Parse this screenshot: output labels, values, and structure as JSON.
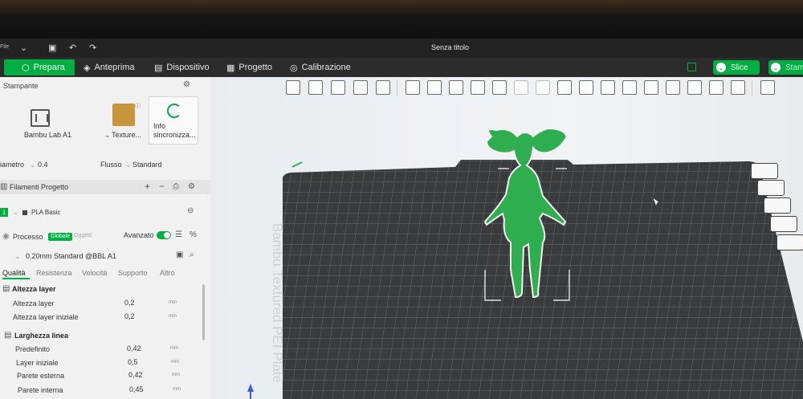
{
  "titlebar": {
    "file_menu": "File",
    "title": "Senza titolo"
  },
  "nav": {
    "tabs": [
      {
        "label": "Prepara",
        "active": true
      },
      {
        "label": "Anteprima"
      },
      {
        "label": "Dispositivo"
      },
      {
        "label": "Progetto"
      },
      {
        "label": "Calibrazione"
      }
    ],
    "slice_label": "Slice",
    "print_label": "Stam"
  },
  "printer": {
    "section_title": "Stampante",
    "printer_name": "Bambu Lab A1",
    "plate_label": "Texture...",
    "sync_line1": "Info",
    "sync_line2": "sincronizza...",
    "nozzle_label": "iametro",
    "nozzle_value": "0.4",
    "flow_label": "Flusso",
    "flow_value": "Standard"
  },
  "filaments": {
    "section_title": "Filamenti Progetto",
    "index": "1",
    "name": "PLA Basic"
  },
  "process": {
    "section_title": "Processo",
    "badge_global": "Globale",
    "badge_objects": "Oggetti",
    "advanced_label": "Avanzato",
    "advanced_on": true,
    "preset": "0.20mm Standard @BBL A1",
    "tabs": [
      "Qualità",
      "Resistenza",
      "Velocità",
      "Supporto",
      "Altro"
    ],
    "groups": [
      {
        "title": "Altezza layer",
        "rows": [
          {
            "label": "Altezza layer",
            "value": "0,2",
            "unit": "mm"
          },
          {
            "label": "Altezza layer iniziale",
            "value": "0,2",
            "unit": "mm"
          }
        ]
      },
      {
        "title": "Larghezza linea",
        "rows": [
          {
            "label": "Predefinito",
            "value": "0,42",
            "unit": "mm"
          },
          {
            "label": "Layer iniziale",
            "value": "0,5",
            "unit": "mm"
          },
          {
            "label": "Parete esterna",
            "value": "0,42",
            "unit": "mm"
          },
          {
            "label": "Parete interna",
            "value": "0,45",
            "unit": "mm"
          }
        ]
      }
    ]
  },
  "viewport": {
    "plate_text": "Bambu Textured PEI Plate",
    "model_color": "#2fae4f",
    "plate_color": "#3a3b3d",
    "accent": "#00ae42"
  }
}
